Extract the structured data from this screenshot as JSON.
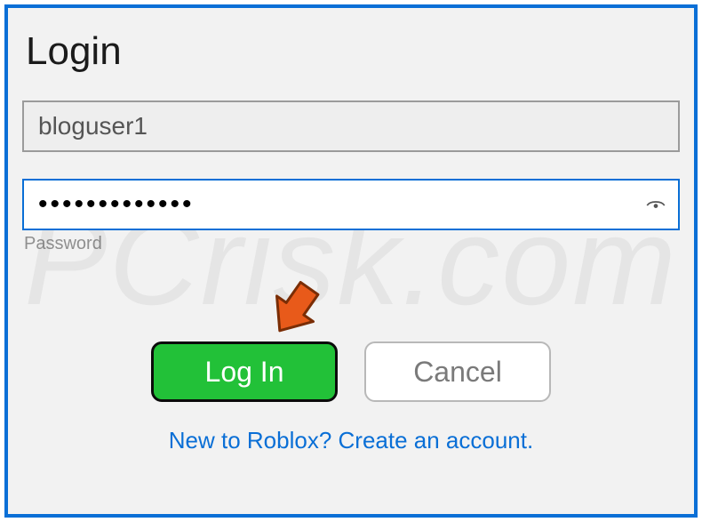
{
  "title": "Login",
  "username": {
    "value": "bloguser1"
  },
  "password": {
    "masked": "•••••••••••••",
    "label": "Password"
  },
  "buttons": {
    "login": "Log In",
    "cancel": "Cancel"
  },
  "link": {
    "text": "New to Roblox? Create an account."
  },
  "watermark": "PCrisk.com",
  "colors": {
    "accent": "#0a6fd6",
    "success": "#22c138"
  }
}
